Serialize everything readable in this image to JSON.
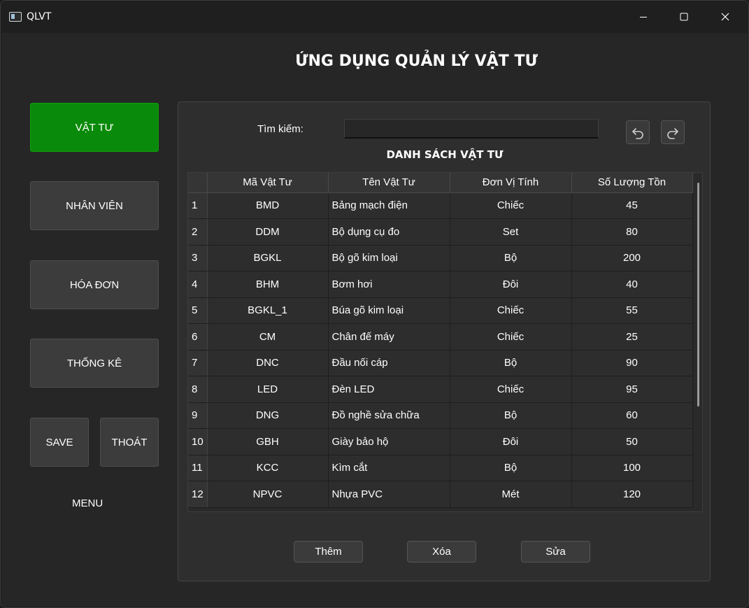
{
  "window": {
    "title": "QLVT"
  },
  "app": {
    "heading": "ỨNG DỤNG QUẢN LÝ VẬT TƯ"
  },
  "sidebar": {
    "materials": "VẬT TƯ",
    "employees": "NHÂN VIÊN",
    "invoices": "HÓA ĐƠN",
    "statistics": "THỐNG KÊ",
    "save": "SAVE",
    "exit": "THOÁT",
    "menu_label": "MENU"
  },
  "search": {
    "label": "Tìm kiếm:",
    "value": ""
  },
  "table": {
    "title": "DANH SÁCH VẬT TƯ",
    "columns": [
      "Mã Vật Tư",
      "Tên Vật Tư",
      "Đơn Vị Tính",
      "Số Lượng Tồn"
    ],
    "rows": [
      [
        "1",
        "BMD",
        "Bảng mạch điện",
        "Chiếc",
        "45"
      ],
      [
        "2",
        "DDM",
        "Bộ dụng cụ đo",
        "Set",
        "80"
      ],
      [
        "3",
        "BGKL",
        "Bộ gõ kim loại",
        "Bộ",
        "200"
      ],
      [
        "4",
        "BHM",
        "Bơm hơi",
        "Đôi",
        "40"
      ],
      [
        "5",
        "BGKL_1",
        "Búa gõ kim loại",
        "Chiếc",
        "55"
      ],
      [
        "6",
        "CM",
        "Chân đế máy",
        "Chiếc",
        "25"
      ],
      [
        "7",
        "DNC",
        "Đầu nối cáp",
        "Bộ",
        "90"
      ],
      [
        "8",
        "LED",
        "Đèn LED",
        "Chiếc",
        "95"
      ],
      [
        "9",
        "DNG",
        "Đồ nghề sửa chữa",
        "Bộ",
        "60"
      ],
      [
        "10",
        "GBH",
        "Giày bảo hộ",
        "Đôi",
        "50"
      ],
      [
        "11",
        "KCC",
        "Kìm cắt",
        "Bộ",
        "100"
      ],
      [
        "12",
        "NPVC",
        "Nhựa PVC",
        "Mét",
        "120"
      ]
    ]
  },
  "actions": {
    "add": "Thêm",
    "delete": "Xóa",
    "edit": "Sửa"
  },
  "colors": {
    "active_nav": "#0a8a0a",
    "background": "#262626",
    "panel": "#2e2e2e"
  },
  "icons": {
    "undo": "undo-icon",
    "redo": "redo-icon",
    "minimize": "minimize-icon",
    "maximize": "maximize-icon",
    "close": "close-icon",
    "app": "app-icon"
  }
}
